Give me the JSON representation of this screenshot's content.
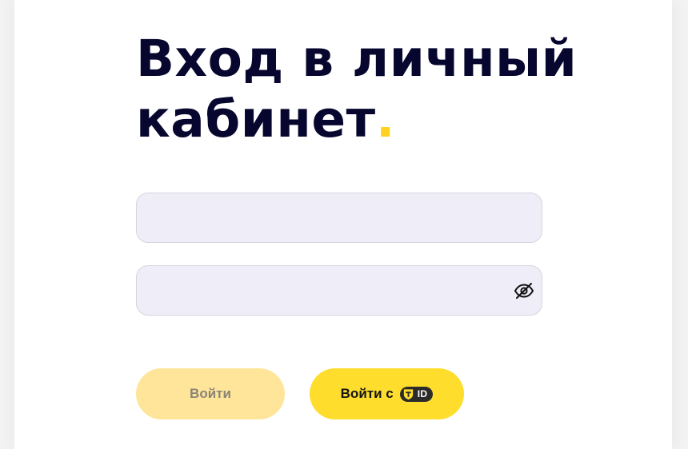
{
  "heading": {
    "line1": "Вход в личный",
    "line2": "кабинет",
    "dot": "."
  },
  "fields": {
    "login": {
      "value": "",
      "placeholder": ""
    },
    "password": {
      "value": "",
      "placeholder": ""
    }
  },
  "icons": {
    "password_toggle": "eye-slash-icon",
    "tid_logo": "t-shield-icon"
  },
  "buttons": {
    "login_label": "Войти",
    "tid_label": "Войти с",
    "tid_badge": "ID"
  },
  "colors": {
    "heading": "#07062e",
    "accent_dot": "#ffd21f",
    "field_bg": "#efedf7",
    "login_button_disabled": "#ffe59a",
    "tid_button": "#ffdd2d"
  }
}
